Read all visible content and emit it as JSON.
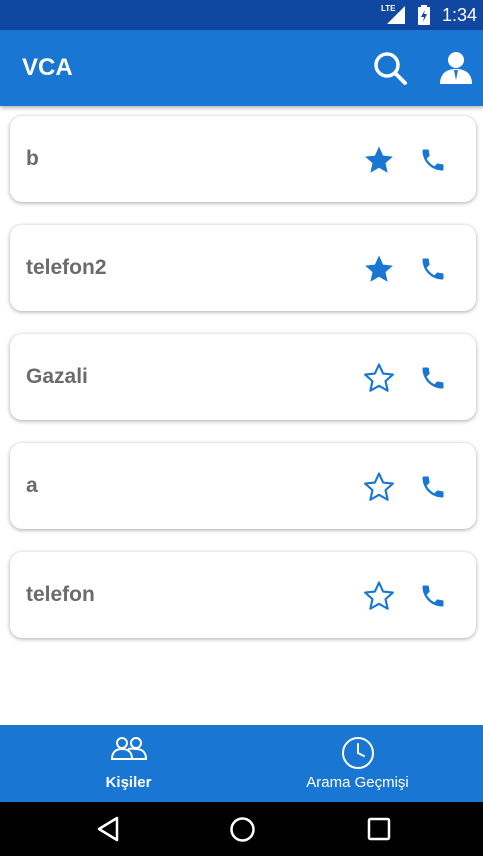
{
  "status_bar": {
    "time": "1:34",
    "network": "LTE",
    "icons": [
      "lte-icon",
      "signal-icon",
      "battery-icon"
    ]
  },
  "app_bar": {
    "title": "VCA",
    "icons": [
      "search-icon",
      "account-icon"
    ]
  },
  "contacts": [
    {
      "name": "b",
      "favorite": true
    },
    {
      "name": "telefon2",
      "favorite": true
    },
    {
      "name": "Gazali",
      "favorite": false
    },
    {
      "name": "a",
      "favorite": false
    },
    {
      "name": "telefon",
      "favorite": false
    }
  ],
  "bottom_nav": {
    "tabs": [
      {
        "label": "Kişiler",
        "icon": "contacts-icon",
        "selected": true
      },
      {
        "label": "Arama Geçmişi",
        "icon": "clock-icon",
        "selected": false
      }
    ]
  },
  "system_nav": {
    "buttons": [
      "back-icon",
      "home-icon",
      "recents-icon"
    ]
  },
  "colors": {
    "primary": "#1976d2",
    "status_bar": "#0f47a1",
    "name_text": "#6b6b6b",
    "icon_blue": "#1976d2"
  }
}
